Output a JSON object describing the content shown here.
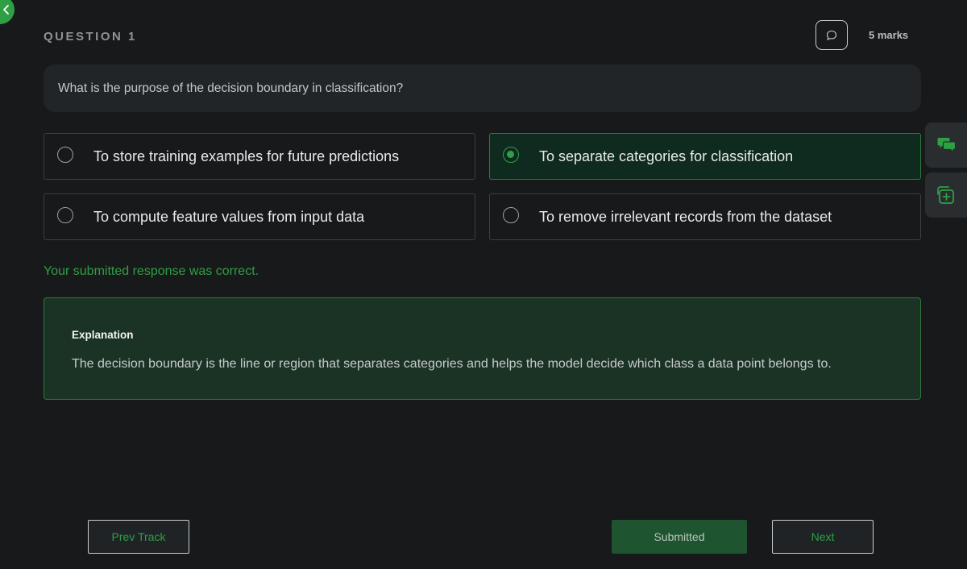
{
  "question": {
    "label": "QUESTION 1",
    "marks": "5 marks",
    "text": "What is the purpose of the decision boundary in classification?"
  },
  "options": [
    {
      "text": "To store training examples for future predictions",
      "selected": false
    },
    {
      "text": "To separate categories for classification",
      "selected": true
    },
    {
      "text": "To compute feature values from input data",
      "selected": false
    },
    {
      "text": "To remove irrelevant records from the dataset",
      "selected": false
    }
  ],
  "result": {
    "message": "Your submitted response was correct."
  },
  "explanation": {
    "title": "Explanation",
    "text": "The decision boundary is the line or region that separates categories and helps the model decide which class a data point belongs to."
  },
  "footer": {
    "prev_label": "Prev Track",
    "submitted_label": "Submitted",
    "next_label": "Next"
  },
  "icons": {
    "back": "chevron-left-icon",
    "comment": "speech-bubble-icon",
    "chat": "chat-bubbles-icon",
    "add": "add-card-icon"
  },
  "colors": {
    "accent": "#2ea043",
    "background": "#17191b",
    "selected_bg": "#0f2a1f",
    "explanation_bg": "#1b3324"
  }
}
